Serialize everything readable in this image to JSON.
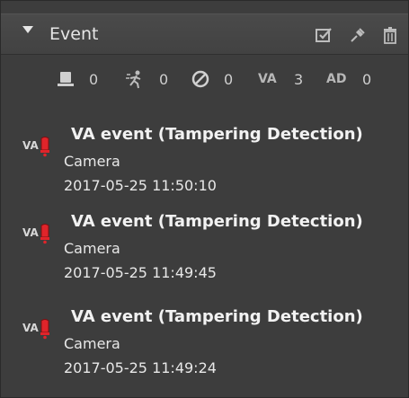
{
  "panel": {
    "title": "Event",
    "tools": [
      "check-all-icon",
      "pin-icon",
      "trash-icon"
    ]
  },
  "counters": [
    {
      "icon": "door-sensor-icon",
      "value": "0"
    },
    {
      "icon": "motion-icon",
      "value": "0"
    },
    {
      "icon": "video-loss-icon",
      "value": "0"
    },
    {
      "label": "VA",
      "value": "3"
    },
    {
      "label": "AD",
      "value": "0"
    }
  ],
  "events": [
    {
      "icon": "va-alarm-icon",
      "icon_label": "VA",
      "title": "VA event (Tampering Detection)",
      "source": "Camera",
      "time": "2017-05-25 11:50:10"
    },
    {
      "icon": "va-alarm-icon",
      "icon_label": "VA",
      "title": "VA event (Tampering Detection)",
      "source": "Camera",
      "time": "2017-05-25 11:49:45"
    },
    {
      "icon": "va-alarm-icon",
      "icon_label": "VA",
      "title": "VA event (Tampering Detection)",
      "source": "Camera",
      "time": "2017-05-25 11:49:24"
    }
  ],
  "colors": {
    "background": "#3d3d3d",
    "header": "#454545",
    "text": "#e8e8e8",
    "alert": "#e0242a"
  }
}
